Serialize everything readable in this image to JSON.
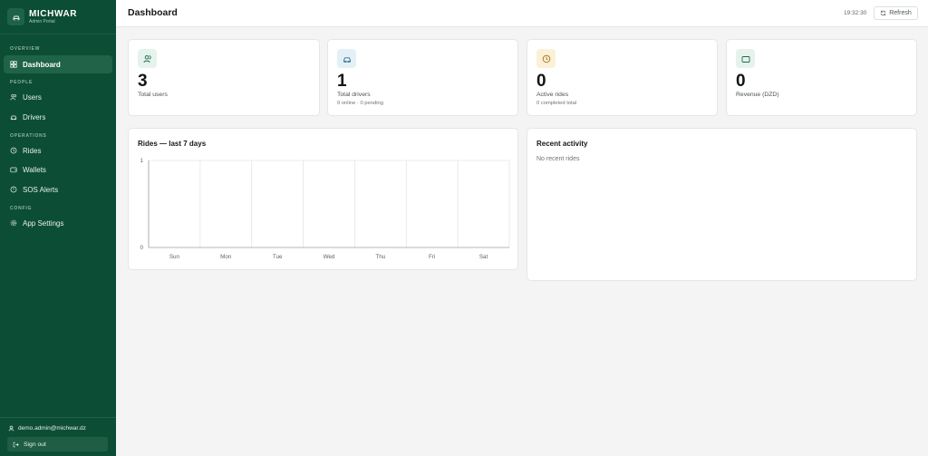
{
  "brand": {
    "name": "MICHWAR",
    "subtitle": "Admin Portal"
  },
  "nav": {
    "sections": [
      "OVERVIEW",
      "PEOPLE",
      "OPERATIONS",
      "CONFIG"
    ],
    "items": [
      {
        "label": "Dashboard",
        "icon": "grid-icon",
        "active": true
      },
      {
        "label": "Users",
        "icon": "users-icon"
      },
      {
        "label": "Drivers",
        "icon": "car-icon"
      },
      {
        "label": "Rides",
        "icon": "clock-icon"
      },
      {
        "label": "Wallets",
        "icon": "wallet-icon"
      },
      {
        "label": "SOS Alerts",
        "icon": "alert-circle-icon"
      },
      {
        "label": "App Settings",
        "icon": "gear-icon"
      }
    ]
  },
  "footer": {
    "user_email": "demo.admin@michwar.dz",
    "sign_out": "Sign out"
  },
  "header": {
    "title": "Dashboard",
    "time": "19:32:30",
    "refresh_label": "Refresh"
  },
  "stats": [
    {
      "value": "3",
      "label": "Total users",
      "sub": "",
      "icon": "users-icon",
      "tint": "#e6f3ec",
      "icon_color": "#1d6a4a"
    },
    {
      "value": "1",
      "label": "Total drivers",
      "sub": "0 online · 0 pending",
      "icon": "car-icon",
      "tint": "#e3f1f7",
      "icon_color": "#2a6f8e"
    },
    {
      "value": "0",
      "label": "Active rides",
      "sub": "0 completed total",
      "icon": "clock-icon",
      "tint": "#fbf0d8",
      "icon_color": "#a8731a"
    },
    {
      "value": "0",
      "label": "Revenue (DZD)",
      "sub": "",
      "icon": "wallet-icon",
      "tint": "#e6f3ec",
      "icon_color": "#1d6a4a"
    }
  ],
  "chart_title": "Rides — last 7 days",
  "chart_data": {
    "type": "bar",
    "categories": [
      "Sun",
      "Mon",
      "Tue",
      "Wed",
      "Thu",
      "Fri",
      "Sat"
    ],
    "values": [
      0,
      0,
      0,
      0,
      0,
      0,
      0
    ],
    "ylim": [
      0,
      1
    ],
    "yticks": [
      "0",
      "1"
    ],
    "grid": true,
    "color": "#1f6b4c"
  },
  "activity": {
    "title": "Recent activity",
    "empty": "No recent rides"
  },
  "colors": {
    "sidebar": "#0c4d36",
    "active_nav": "#1f6348",
    "accent": "#1f6b4c"
  }
}
